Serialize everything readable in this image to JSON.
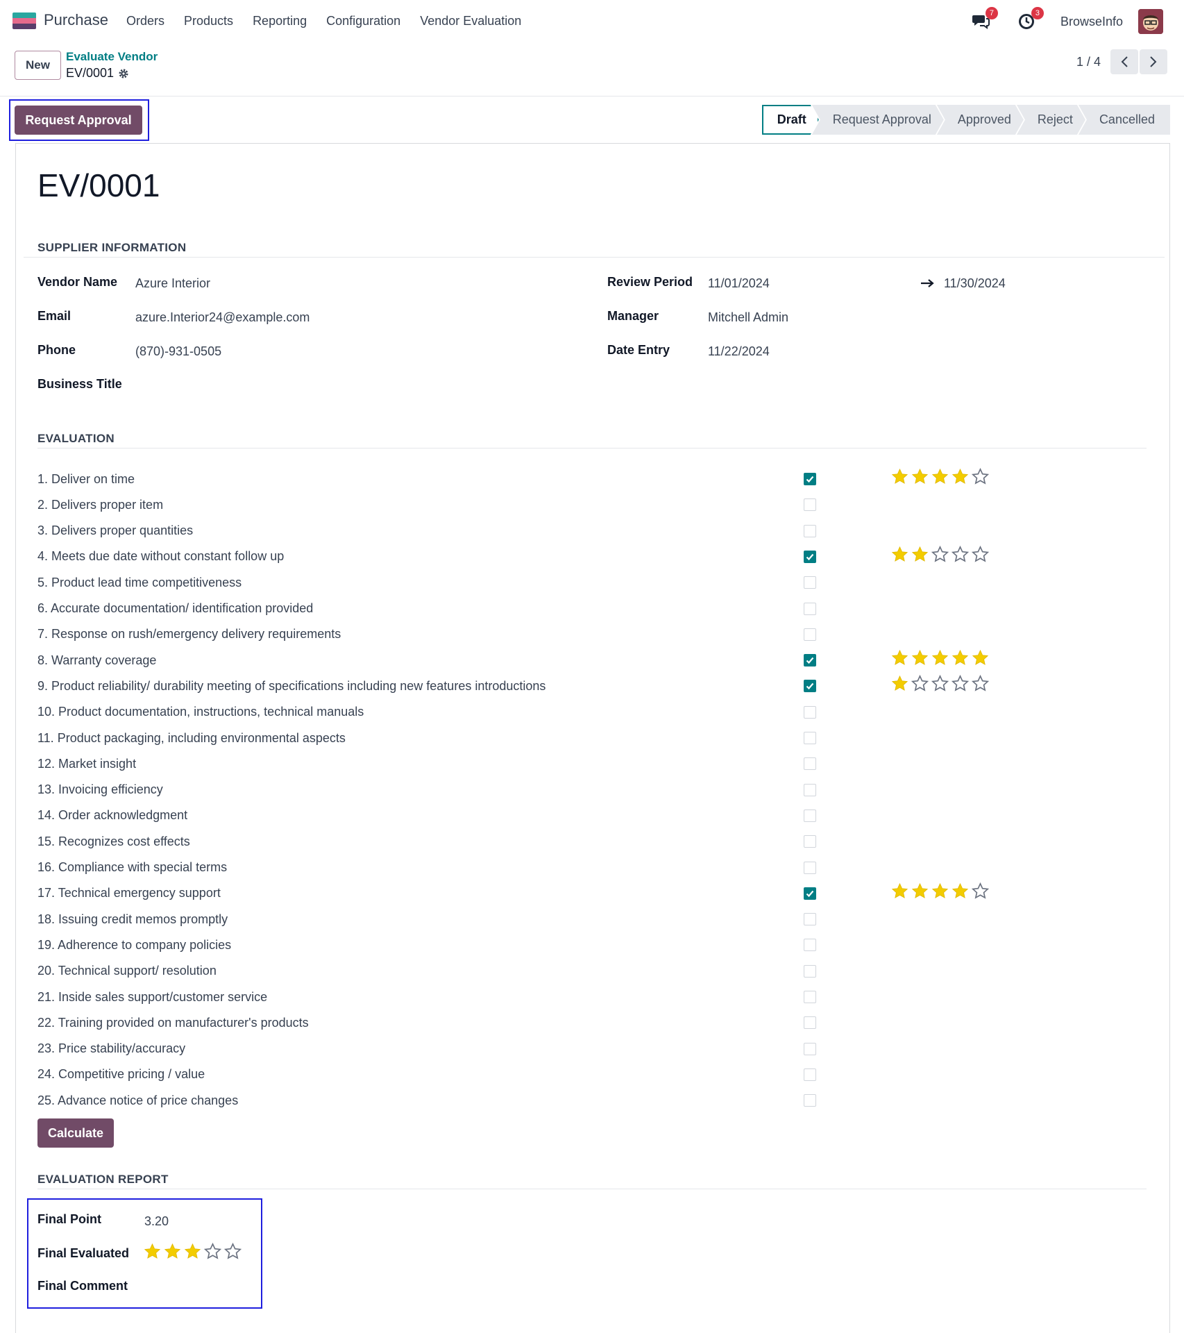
{
  "navbar": {
    "app_name": "Purchase",
    "app_icon": "purchase-app-icon",
    "menu": [
      "Orders",
      "Products",
      "Reporting",
      "Configuration",
      "Vendor Evaluation"
    ],
    "messages_badge": "7",
    "activities_badge": "3",
    "user_name": "BrowseInfo"
  },
  "control": {
    "new_label": "New",
    "breadcrumb_parent": "Evaluate Vendor",
    "breadcrumb_current": "EV/0001",
    "pager_value": "1 / 4"
  },
  "actions": {
    "request_approval_label": "Request Approval"
  },
  "statusbar": {
    "stages": [
      "Draft",
      "Request Approval",
      "Approved",
      "Reject",
      "Cancelled"
    ],
    "active_stage": "Draft"
  },
  "record": {
    "title": "EV/0001"
  },
  "supplier": {
    "section_title": "SUPPLIER INFORMATION",
    "vendor_name_label": "Vendor Name",
    "vendor_name": "Azure Interior",
    "email_label": "Email",
    "email": "azure.Interior24@example.com",
    "phone_label": "Phone",
    "phone": "(870)-931-0505",
    "business_title_label": "Business Title",
    "business_title": "",
    "review_period_label": "Review Period",
    "review_start": "11/01/2024",
    "review_end": "11/30/2024",
    "manager_label": "Manager",
    "manager": "Mitchell Admin",
    "date_entry_label": "Date Entry",
    "date_entry": "11/22/2024"
  },
  "evaluation": {
    "section_title": "EVALUATION",
    "items": [
      {
        "label": "1. Deliver on time",
        "checked": true,
        "stars": 4
      },
      {
        "label": "2. Delivers proper item",
        "checked": false,
        "stars": 0
      },
      {
        "label": "3. Delivers proper quantities",
        "checked": false,
        "stars": 0
      },
      {
        "label": "4. Meets due date without constant follow up",
        "checked": true,
        "stars": 2
      },
      {
        "label": "5. Product lead time competitiveness",
        "checked": false,
        "stars": 0
      },
      {
        "label": "6. Accurate documentation/ identification provided",
        "checked": false,
        "stars": 0
      },
      {
        "label": "7. Response on rush/emergency delivery requirements",
        "checked": false,
        "stars": 0
      },
      {
        "label": "8. Warranty coverage",
        "checked": true,
        "stars": 5
      },
      {
        "label": "9. Product reliability/ durability meeting of specifications including new features introductions",
        "checked": true,
        "stars": 1
      },
      {
        "label": "10. Product documentation, instructions, technical manuals",
        "checked": false,
        "stars": 0
      },
      {
        "label": "11. Product packaging, including environmental aspects",
        "checked": false,
        "stars": 0
      },
      {
        "label": "12. Market insight",
        "checked": false,
        "stars": 0
      },
      {
        "label": "13. Invoicing efficiency",
        "checked": false,
        "stars": 0
      },
      {
        "label": "14. Order acknowledgment",
        "checked": false,
        "stars": 0
      },
      {
        "label": "15. Recognizes cost effects",
        "checked": false,
        "stars": 0
      },
      {
        "label": "16. Compliance with special terms",
        "checked": false,
        "stars": 0
      },
      {
        "label": "17. Technical emergency support",
        "checked": true,
        "stars": 4
      },
      {
        "label": "18. Issuing credit memos promptly",
        "checked": false,
        "stars": 0
      },
      {
        "label": "19. Adherence to company policies",
        "checked": false,
        "stars": 0
      },
      {
        "label": "20. Technical support/ resolution",
        "checked": false,
        "stars": 0
      },
      {
        "label": "21. Inside sales support/customer service",
        "checked": false,
        "stars": 0
      },
      {
        "label": "22. Training provided on manufacturer's products",
        "checked": false,
        "stars": 0
      },
      {
        "label": "23. Price stability/accuracy",
        "checked": false,
        "stars": 0
      },
      {
        "label": "24. Competitive pricing / value",
        "checked": false,
        "stars": 0
      },
      {
        "label": "25. Advance notice of price changes",
        "checked": false,
        "stars": 0
      }
    ],
    "calculate_label": "Calculate"
  },
  "report": {
    "section_title": "EVALUATION REPORT",
    "final_point_label": "Final Point",
    "final_point": "3.20",
    "final_evaluated_label": "Final Evaluated",
    "final_evaluated_stars": 3,
    "final_comment_label": "Final Comment",
    "final_comment": ""
  },
  "colors": {
    "primary": "#714b67",
    "teal": "#017e84",
    "star_filled": "#f3cc00",
    "star_empty_stroke": "#6b7280",
    "highlight": "#1f1fde"
  }
}
